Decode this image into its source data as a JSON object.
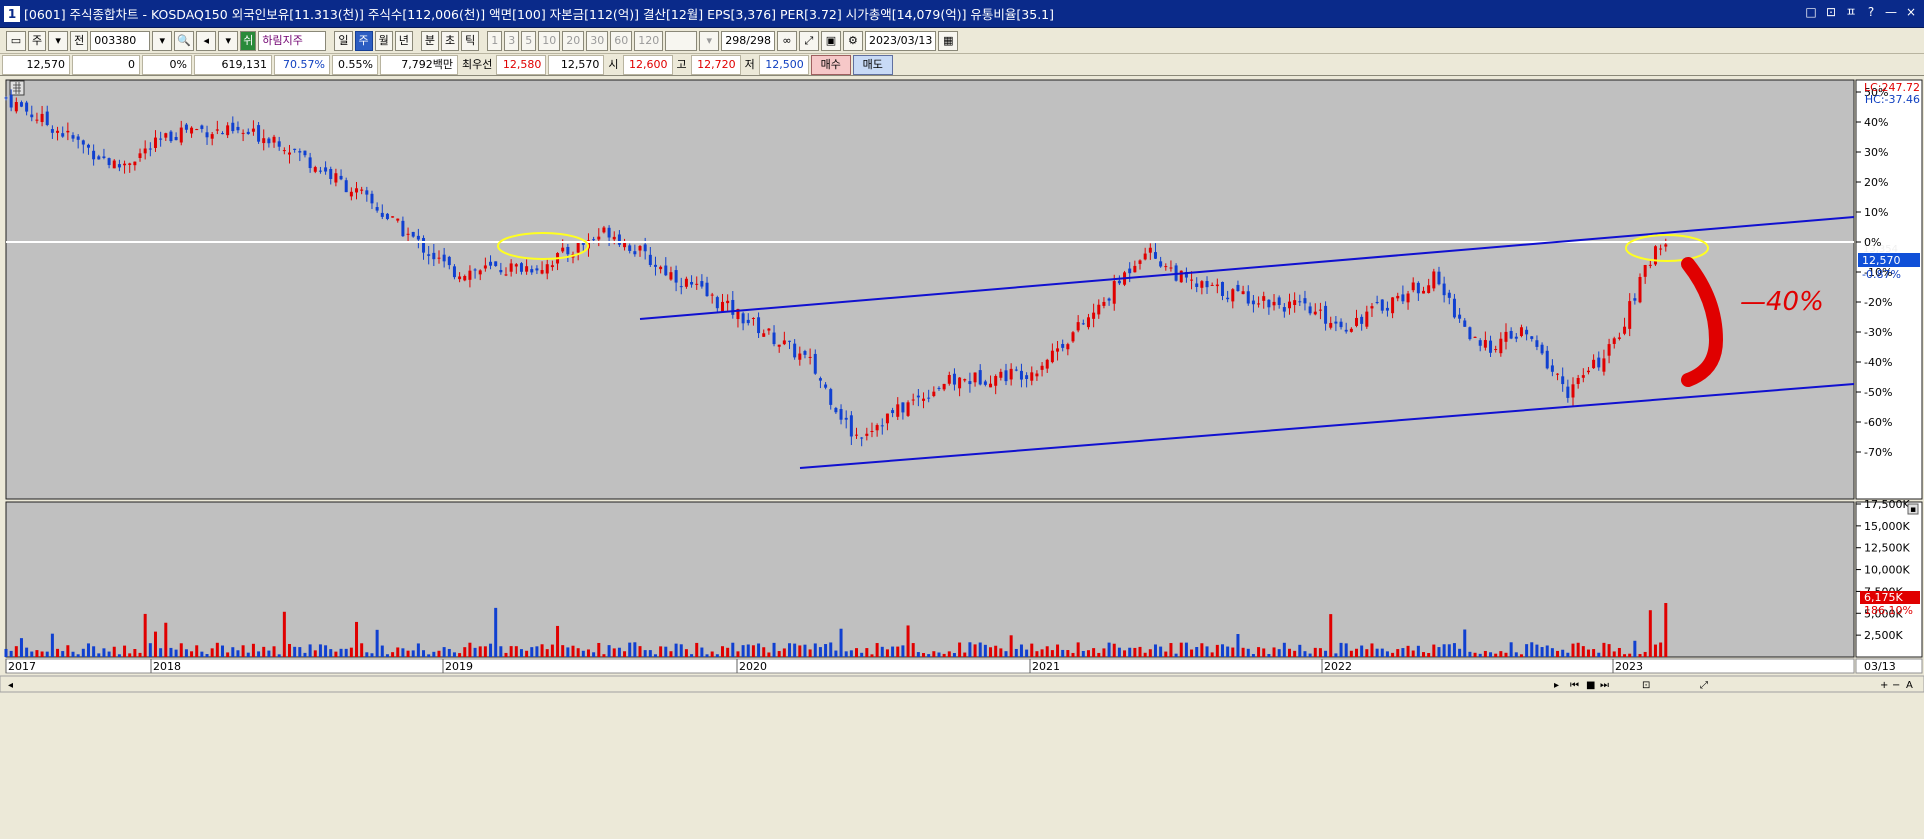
{
  "window": {
    "title": "[0601] 주식종합차트 - KOSDAQ150 외국인보유[11.313(천)] 주식수[112,006(천)] 액면[100] 자본금[112(억)] 결산[12월] EPS[3,376] PER[3.72] 시가총액[14,079(억)] 유통비율[35.1]",
    "app_icon": "1",
    "controls": [
      "□",
      "⊡",
      "ㅍ",
      "?",
      "—",
      "×"
    ]
  },
  "toolbar": {
    "mode": "주",
    "scope": "전",
    "code": "003380",
    "badge": "쉬",
    "name": "하림지주",
    "periods": [
      "일",
      "주",
      "월",
      "년"
    ],
    "active_period": "주",
    "intervals": [
      "분",
      "초",
      "틱"
    ],
    "minutes": [
      "1",
      "3",
      "5",
      "10",
      "20",
      "30",
      "60",
      "120"
    ],
    "count": "298/298",
    "date": "2023/03/13"
  },
  "quote": {
    "price": "12,570",
    "change": "0",
    "change_pct": "0%",
    "volume": "619,131",
    "ratio": "70.57%",
    "turnover": "0.55%",
    "amount": "7,792백만",
    "label_bid": "최우선",
    "bid": "12,580",
    "ask": "12,570",
    "label_open": "시",
    "open": "12,600",
    "label_high": "고",
    "high": "12,720",
    "label_low": "저",
    "low": "12,500",
    "buy_label": "매수",
    "sell_label": "매도"
  },
  "price_axis": {
    "lc": "LC:247.72",
    "hc": "HC:-37.46",
    "labels": [
      "50%",
      "40%",
      "30%",
      "20%",
      "10%",
      "0%",
      "-10%",
      "-20%",
      "-30%",
      "-40%",
      "-50%",
      "-60%",
      "-70%"
    ],
    "current_price": "12,570",
    "current_pct": "-0.87%",
    "hline_value": "13,354"
  },
  "volume_axis": {
    "labels": [
      "17,500K",
      "15,000K",
      "12,500K",
      "10,000K",
      "7,500K",
      "5,000K",
      "2,500K"
    ],
    "current_volume": "6,175K",
    "current_pct": "186.10%"
  },
  "time_axis": {
    "labels": [
      "2017",
      "2018",
      "2019",
      "2020",
      "2021",
      "2022",
      "2023"
    ],
    "end_date": "03/13"
  },
  "annotation": {
    "text": "—40%",
    "color": "#e00000"
  },
  "colors": {
    "up": "#e00000",
    "down": "#1040d0",
    "channel": "#1010d0",
    "ellipse": "#ffff20",
    "chart_bg": "#c0c0c0"
  },
  "chart_data": [
    {
      "type": "candlestick",
      "x_start": "2017-01",
      "x_end": "2023-03-13",
      "y_unit": "% vs reference price",
      "ylim": [
        -73,
        60
      ],
      "horizontal_line": 13354,
      "channel_upper": [
        {
          "x": "2019-08",
          "y": -20
        },
        {
          "x": "2023-03",
          "y": 14
        }
      ],
      "channel_lower": [
        {
          "x": "2020-03",
          "y": -68
        },
        {
          "x": "2023-03",
          "y": -41
        }
      ],
      "close_path": [
        {
          "x": "2017-01",
          "y": 48
        },
        {
          "x": "2017-06",
          "y": 25
        },
        {
          "x": "2017-09",
          "y": 38
        },
        {
          "x": "2018-01",
          "y": 35
        },
        {
          "x": "2018-05",
          "y": 15
        },
        {
          "x": "2018-09",
          "y": -10
        },
        {
          "x": "2019-01",
          "y": -8
        },
        {
          "x": "2019-04",
          "y": 4
        },
        {
          "x": "2019-06",
          "y": -7
        },
        {
          "x": "2019-10",
          "y": -25
        },
        {
          "x": "2020-01",
          "y": -40
        },
        {
          "x": "2020-03",
          "y": -65
        },
        {
          "x": "2020-07",
          "y": -47
        },
        {
          "x": "2020-11",
          "y": -43
        },
        {
          "x": "2021-02",
          "y": -22
        },
        {
          "x": "2021-04",
          "y": -2
        },
        {
          "x": "2021-06",
          "y": -14
        },
        {
          "x": "2021-11",
          "y": -22
        },
        {
          "x": "2022-01",
          "y": -28
        },
        {
          "x": "2022-05",
          "y": -12
        },
        {
          "x": "2022-07",
          "y": -36
        },
        {
          "x": "2022-09",
          "y": -30
        },
        {
          "x": "2022-11",
          "y": -50
        },
        {
          "x": "2023-01",
          "y": -35
        },
        {
          "x": "2023-03",
          "y": 0
        }
      ]
    },
    {
      "type": "bar",
      "name": "volume",
      "y_unit": "K shares",
      "ylim": [
        0,
        17500
      ],
      "last_value": 6175
    }
  ]
}
